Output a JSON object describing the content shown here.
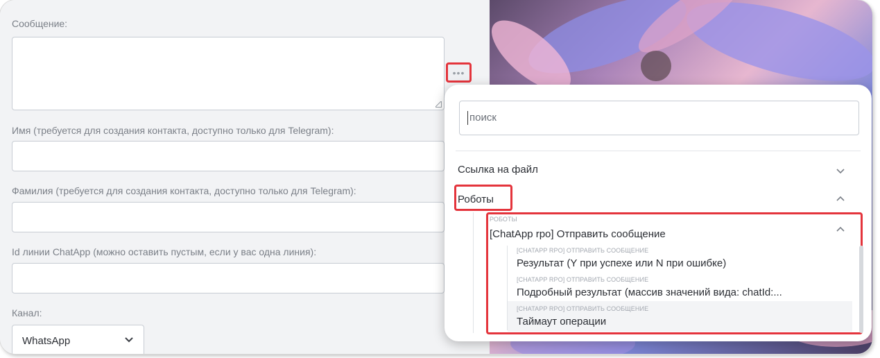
{
  "form": {
    "message_label": "Сообщение:",
    "first_name_label": "Имя (требуется для создания контакта, доступно только для Telegram):",
    "last_name_label": "Фамилия (требуется для создания контакта, доступно только для Telegram):",
    "line_id_label": "Id линии ChatApp (можно оставить пустым, если у вас одна линия):",
    "channel_label": "Канал:",
    "channel_value": "WhatsApp",
    "more_button": "•••"
  },
  "popup": {
    "search_placeholder": "поиск",
    "groups": [
      {
        "label": "Ссылка на файл",
        "expanded": false
      },
      {
        "label": "Роботы",
        "expanded": true
      }
    ],
    "subgroup": {
      "caption": "роботы",
      "label": "[ChatApp rpo] Отправить сообщение",
      "expanded": true,
      "items": [
        {
          "caption": "[chatapp rpo] отправить сообщение",
          "label": "Результат (Y при успехе или N при ошибке)"
        },
        {
          "caption": "[chatapp rpo] отправить сообщение",
          "label": "Подробный результат (массив значений вида: chatId:..."
        },
        {
          "caption": "[chatapp rpo] отправить сообщение",
          "label": "Таймаут операции"
        }
      ]
    }
  },
  "colors": {
    "highlight": "#e4343c",
    "text": "#2a2d33",
    "label": "#7a7f87"
  }
}
